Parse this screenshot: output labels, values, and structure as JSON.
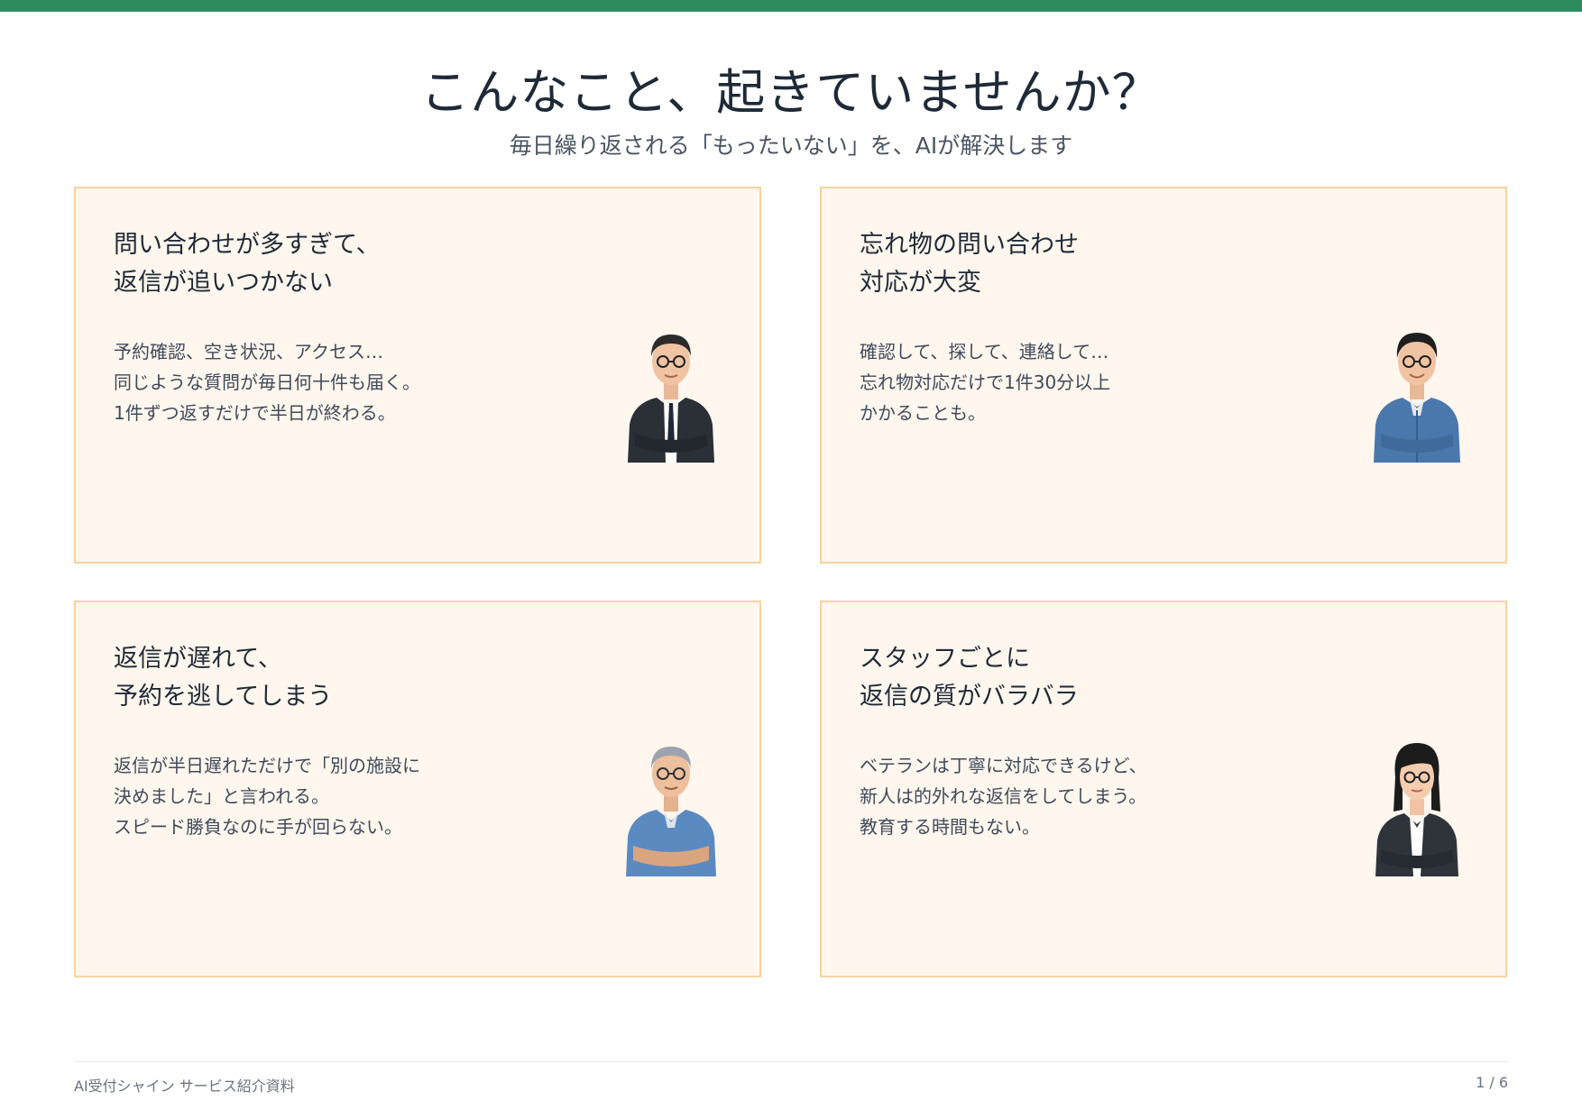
{
  "header": {
    "title": "こんなこと、起きていませんか？",
    "subtitle": "毎日繰り返される「もったいない」を、AIが解決します"
  },
  "cards": [
    {
      "title_lines": [
        "問い合わせが多すぎて、",
        "返信が追いつかない"
      ],
      "body_lines": [
        "予約確認、空き状況、アクセス…",
        "同じような質問が毎日何十件も届く。",
        "1件ずつ返すだけで半日が終わる。"
      ],
      "icon": "businessman-suit-icon"
    },
    {
      "title_lines": [
        "忘れ物の問い合わせ",
        "対応が大変"
      ],
      "body_lines": [
        "確認して、探して、連絡して…",
        "忘れ物対応だけで1件30分以上",
        "かかることも。"
      ],
      "icon": "worker-blue-uniform-icon"
    },
    {
      "title_lines": [
        "返信が遅れて、",
        "予約を逃してしまう"
      ],
      "body_lines": [
        "返信が半日遅れただけで「別の施設に",
        "決めました」と言われる。",
        "スピード勝負なのに手が回らない。"
      ],
      "icon": "senior-worker-icon"
    },
    {
      "title_lines": [
        "スタッフごとに",
        "返信の質がバラバラ"
      ],
      "body_lines": [
        "ベテランは丁寧に対応できるけど、",
        "新人は的外れな返信をしてしまう。",
        "教育する時間もない。"
      ],
      "icon": "businesswoman-suit-icon"
    }
  ],
  "footer": {
    "left": "AI受付シャイン サービス紹介資料",
    "page": "1 / 6"
  },
  "colors": {
    "accent": "#2e8b5e",
    "card_bg": "#fff6ee",
    "card_border": "#f7d3a1"
  }
}
